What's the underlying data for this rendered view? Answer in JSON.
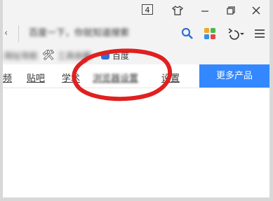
{
  "titlebar": {
    "tab_count": "4",
    "buttons": [
      "shirt-icon",
      "minimize-icon",
      "restore-icon",
      "close-icon"
    ]
  },
  "address": {
    "url_text": "百度一下，你就知道搜索",
    "chevron": "‹"
  },
  "bookmarks": {
    "items": [
      {
        "label": "网址导航"
      },
      {
        "label": "工具收藏"
      },
      {
        "label": "百度"
      }
    ]
  },
  "nav": {
    "items": [
      "频",
      "贴吧",
      "学术",
      "浏览器设置",
      "设置"
    ],
    "more_label": "更多产品"
  },
  "colors": {
    "accent": "#3388ff",
    "annotation": "#e02020"
  }
}
